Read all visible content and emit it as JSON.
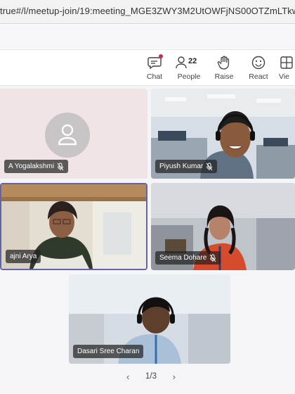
{
  "browser": {
    "url": "true#/l/meetup-join/19:meeting_MGE3ZWY3M2UtOWFjNS00OTZmLTkwZmU"
  },
  "toolbar": {
    "chat_label": "Chat",
    "people_label": "People",
    "people_count": "22",
    "raise_label": "Raise",
    "react_label": "React",
    "view_label": "Vie"
  },
  "participants": [
    {
      "name": "A Yogalakshmi",
      "muted": true
    },
    {
      "name": "Piyush Kumar",
      "muted": true
    },
    {
      "name": "ajni Arya",
      "muted": false
    },
    {
      "name": "Seema Dohare",
      "muted": true
    },
    {
      "name": "Dasari Sree Charan",
      "muted": false
    }
  ],
  "pager": {
    "text": "1/3"
  },
  "colors": {
    "accent": "#6264a7",
    "notification": "#c4314b"
  },
  "icons": {
    "chat": "chat-icon",
    "people": "people-icon",
    "raise": "hand-icon",
    "react": "smiley-icon",
    "view": "grid-icon",
    "mic_off": "mic-off-icon",
    "avatar": "person-icon"
  }
}
